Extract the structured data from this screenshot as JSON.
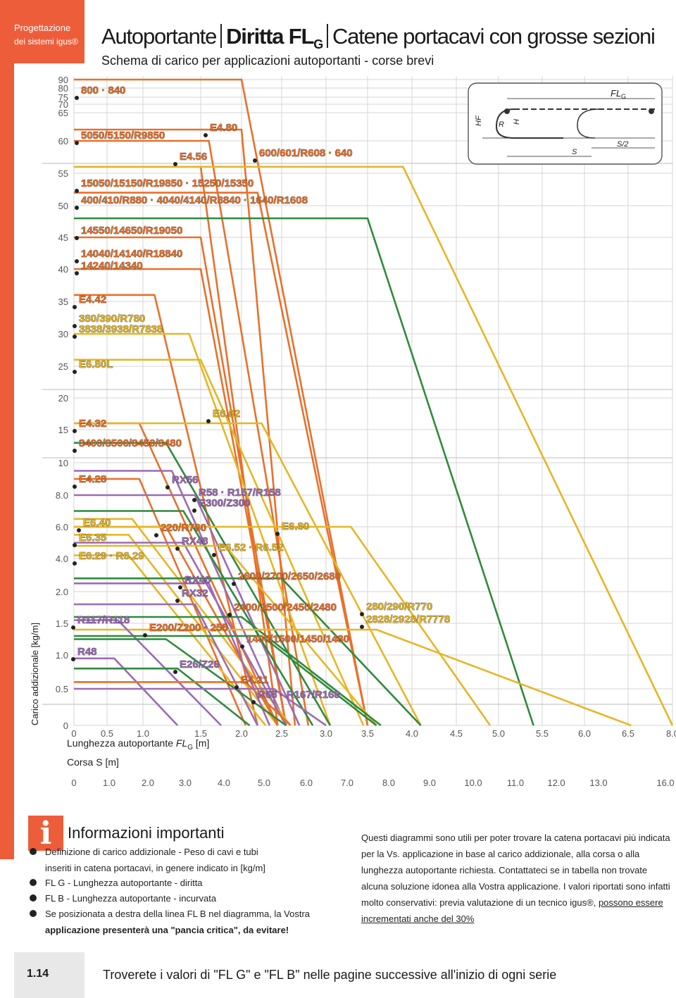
{
  "header": {
    "section_line1": "Progettazione",
    "section_line2": "dei sistemi igus®",
    "title_part1": "Autoportante",
    "title_part2": "Diritta FL",
    "title_part2_sub": "G",
    "title_part3": "Catene portacavi con grosse sezioni",
    "subtitle": "Schema di carico per applicazioni autoportanti - corse brevi"
  },
  "colors": {
    "accent": "#ee5d3a"
  },
  "chart_data": {
    "type": "line",
    "title": "Schema di carico per applicazioni autoportanti - corse brevi",
    "ylabel": "Carico addizionale [kg/m]",
    "xlabel": "Lunghezza autoportante FL",
    "xlabel_sub": "G",
    "xlabel_unit": "[m]",
    "x2label": "Corsa S [m]",
    "y_ticks": [
      "0",
      "0.5",
      "1.0",
      "1.5",
      "2.0",
      "4.0",
      "6.0",
      "8.0",
      "10",
      "15",
      "20",
      "25",
      "30",
      "35",
      "40",
      "45",
      "50",
      "55",
      "60",
      "65",
      "70",
      "75",
      "80",
      "90"
    ],
    "x_ticks": [
      "0",
      "0.5",
      "1.0",
      "1.5",
      "2.0",
      "2.5",
      "3.0",
      "3.5",
      "4.0",
      "4.5",
      "5.0",
      "5.5",
      "6.0",
      "6.5",
      "8.0"
    ],
    "x2_ticks": [
      "0",
      "1.0",
      "2.0",
      "3.0",
      "4.0",
      "5.0",
      "6.0",
      "7.0",
      "8.0",
      "9.0",
      "10.0",
      "11.0",
      "12.0",
      "13.0",
      "16.0"
    ],
    "grid": true,
    "series": [
      {
        "name": "800 · 840",
        "color": "#e8702a",
        "points": [
          [
            0,
            90
          ],
          [
            2.0,
            90
          ],
          [
            3.5,
            0
          ]
        ]
      },
      {
        "name": "5050/5150/R9850",
        "color": "#e8702a",
        "points": [
          [
            0,
            60
          ],
          [
            1.6,
            60
          ],
          [
            2.8,
            0
          ]
        ]
      },
      {
        "name": "E4.80",
        "color": "#e8702a",
        "points": [
          [
            0,
            62
          ],
          [
            2.0,
            62
          ],
          [
            2.65,
            0
          ]
        ]
      },
      {
        "name": "E4.56",
        "color": "#e8702a",
        "points": [
          [
            0,
            56
          ],
          [
            1.5,
            56
          ],
          [
            2.45,
            0
          ]
        ]
      },
      {
        "name": "600/601/R608 · 640",
        "color": "#e6b625",
        "points": [
          [
            0,
            56
          ],
          [
            3.9,
            56
          ],
          [
            8.0,
            0
          ]
        ]
      },
      {
        "name": "15050/15150/R19850 · 15250/15350",
        "color": "#e8702a",
        "points": [
          [
            0,
            52
          ],
          [
            2.2,
            52
          ],
          [
            3.5,
            0
          ]
        ]
      },
      {
        "name": "400/410/R880 · 4040/4140/R8840 · 1640/R1608",
        "color": "#2f8a3d",
        "points": [
          [
            0,
            48
          ],
          [
            3.5,
            48
          ],
          [
            5.4,
            0
          ]
        ]
      },
      {
        "name": "14550/14650/R19050",
        "color": "#e8702a",
        "points": [
          [
            0,
            45
          ],
          [
            1.5,
            45
          ],
          [
            2.55,
            0
          ]
        ]
      },
      {
        "name": "14040/14140/R18840 · 14240/14340",
        "color": "#e8702a",
        "points": [
          [
            0,
            40
          ],
          [
            1.5,
            40
          ],
          [
            2.55,
            0
          ]
        ]
      },
      {
        "name": "E4.42",
        "color": "#e8702a",
        "points": [
          [
            0,
            36
          ],
          [
            1.1,
            36
          ],
          [
            2.2,
            0
          ]
        ]
      },
      {
        "name": "380/390/R780 · 3838/3938/R7838",
        "color": "#e6b625",
        "points": [
          [
            0,
            30
          ],
          [
            1.4,
            30
          ],
          [
            3.05,
            0
          ]
        ]
      },
      {
        "name": "E6.80L",
        "color": "#e6b625",
        "points": [
          [
            0,
            26
          ],
          [
            1.5,
            26
          ],
          [
            3.45,
            0
          ]
        ]
      },
      {
        "name": "E4.32",
        "color": "#e8702a",
        "points": [
          [
            0,
            16
          ],
          [
            0.95,
            16
          ],
          [
            2.45,
            0
          ]
        ]
      },
      {
        "name": "3400/3500/3450/3480",
        "color": "#2f8a3d",
        "points": [
          [
            0,
            13
          ],
          [
            1.2,
            13
          ],
          [
            3.05,
            0
          ]
        ]
      },
      {
        "name": "E6.62",
        "color": "#e6b625",
        "points": [
          [
            0,
            16
          ],
          [
            2.25,
            16
          ],
          [
            4.1,
            0
          ]
        ]
      },
      {
        "name": "E4.28",
        "color": "#e8702a",
        "points": [
          [
            0,
            9
          ],
          [
            0.95,
            9
          ],
          [
            2.05,
            0
          ]
        ]
      },
      {
        "name": "RX56",
        "color": "#9b6bb5",
        "points": [
          [
            0,
            9.5
          ],
          [
            1.25,
            9.5
          ],
          [
            2.55,
            0
          ]
        ]
      },
      {
        "name": "R58 · R157/R158",
        "color": "#9b6bb5",
        "points": [
          [
            0,
            8
          ],
          [
            1.45,
            8
          ],
          [
            2.7,
            0
          ]
        ]
      },
      {
        "name": "E300/Z300",
        "color": "#2f8a3d",
        "points": [
          [
            0,
            7
          ],
          [
            1.35,
            7
          ],
          [
            2.85,
            0
          ]
        ]
      },
      {
        "name": "E6.40",
        "color": "#e6b625",
        "points": [
          [
            0,
            6.5
          ],
          [
            0.85,
            6.5
          ],
          [
            2.6,
            0
          ]
        ]
      },
      {
        "name": "E6.35",
        "color": "#e6b625",
        "points": [
          [
            0,
            5.5
          ],
          [
            0.8,
            5.5
          ],
          [
            2.45,
            0
          ]
        ]
      },
      {
        "name": "E6.29 · R6.29",
        "color": "#e6b625",
        "points": [
          [
            0,
            4.2
          ],
          [
            0.8,
            4.2
          ],
          [
            2.3,
            0
          ]
        ]
      },
      {
        "name": "220/R760",
        "color": "#e8702a",
        "points": [
          [
            0,
            6
          ],
          [
            1.2,
            6
          ],
          [
            2.45,
            0
          ]
        ]
      },
      {
        "name": "RX48",
        "color": "#9b6bb5",
        "points": [
          [
            0,
            5
          ],
          [
            1.35,
            5
          ],
          [
            2.55,
            0
          ]
        ]
      },
      {
        "name": "E6.80",
        "color": "#e6b625",
        "points": [
          [
            0,
            6
          ],
          [
            3.3,
            6
          ],
          [
            4.9,
            0
          ]
        ]
      },
      {
        "name": "E6.52 · R6.52",
        "color": "#e6b625",
        "points": [
          [
            0,
            4.8
          ],
          [
            1.8,
            4.8
          ],
          [
            3.6,
            0
          ]
        ]
      },
      {
        "name": "RX40",
        "color": "#9b6bb5",
        "points": [
          [
            0,
            2.5
          ],
          [
            1.6,
            2.5
          ],
          [
            2.35,
            0
          ]
        ]
      },
      {
        "name": "2600/2700/2650/2680",
        "color": "#2f8a3d",
        "points": [
          [
            0,
            2.8
          ],
          [
            2.5,
            2.8
          ],
          [
            4.1,
            0
          ]
        ]
      },
      {
        "name": "RX32",
        "color": "#9b6bb5",
        "points": [
          [
            0,
            1.8
          ],
          [
            1.45,
            1.8
          ],
          [
            2.2,
            0
          ]
        ]
      },
      {
        "name": "2400/2500/2450/2480",
        "color": "#2f8a3d",
        "points": [
          [
            0,
            1.6
          ],
          [
            2.0,
            1.6
          ],
          [
            3.65,
            0
          ]
        ]
      },
      {
        "name": "280/290/R770 · 2828/2928/R7778",
        "color": "#e6b625",
        "points": [
          [
            0,
            1.4
          ],
          [
            3.6,
            1.4
          ],
          [
            6.6,
            0
          ]
        ]
      },
      {
        "name": "R117/R118",
        "color": "#9b6bb5",
        "points": [
          [
            0,
            1.55
          ],
          [
            0.65,
            1.55
          ],
          [
            1.75,
            0
          ]
        ]
      },
      {
        "name": "E200/Z200 · 255",
        "color": "#2f8a3d",
        "points": [
          [
            0,
            1.25
          ],
          [
            1.2,
            1.25
          ],
          [
            2.55,
            0
          ]
        ]
      },
      {
        "name": "1400/1500/1450/1480",
        "color": "#2f8a3d",
        "points": [
          [
            0,
            1.3
          ],
          [
            2.25,
            1.3
          ],
          [
            3.6,
            0
          ]
        ]
      },
      {
        "name": "R48",
        "color": "#9b6bb5",
        "points": [
          [
            0,
            0.95
          ],
          [
            0.6,
            0.95
          ],
          [
            1.3,
            0
          ]
        ]
      },
      {
        "name": "E26/Z26",
        "color": "#2f8a3d",
        "points": [
          [
            0,
            0.8
          ],
          [
            1.3,
            0.8
          ],
          [
            2.1,
            0
          ]
        ]
      },
      {
        "name": "E4.21",
        "color": "#e8702a",
        "points": [
          [
            0,
            0.6
          ],
          [
            2.05,
            0.6
          ],
          [
            2.6,
            0
          ]
        ]
      },
      {
        "name": "R68 · R167/R168",
        "color": "#9b6bb5",
        "points": [
          [
            0,
            0.5
          ],
          [
            2.4,
            0.5
          ],
          [
            3.0,
            0
          ]
        ]
      }
    ],
    "labels": [
      {
        "text": "800 · 840",
        "color": "#e8702a"
      },
      {
        "text": "5050/5150/R9850",
        "color": "#e8702a"
      },
      {
        "text": "E4.80",
        "color": "#e8702a"
      },
      {
        "text": "E4.56",
        "color": "#e8702a"
      },
      {
        "text": "600/601/R608 · 640",
        "color": "#e8702a"
      },
      {
        "text": "15050/15150/R19850 · 15250/15350",
        "color": "#e8702a"
      },
      {
        "text": "400/410/R880 · 4040/4140/R8840 · 1640/R1608",
        "color": "#e8702a"
      },
      {
        "text": "14550/14650/R19050",
        "color": "#e8702a"
      },
      {
        "text": "14040/14140/R18840",
        "color": "#e8702a"
      },
      {
        "text": "14240/14340",
        "color": "#e8702a"
      },
      {
        "text": "E4.42",
        "color": "#e8702a"
      },
      {
        "text": "380/390/R780",
        "color": "#e6b625"
      },
      {
        "text": "3838/3938/R7838",
        "color": "#e6b625"
      },
      {
        "text": "E6.80L",
        "color": "#e6b625"
      },
      {
        "text": "E4.32",
        "color": "#e8702a"
      },
      {
        "text": "3400/3500/3450/3480",
        "color": "#e8702a"
      },
      {
        "text": "E6.62",
        "color": "#e6b625"
      },
      {
        "text": "E4.28",
        "color": "#e8702a"
      },
      {
        "text": "RX56",
        "color": "#9b6bb5"
      },
      {
        "text": "R58 · R157/R158",
        "color": "#9b6bb5"
      },
      {
        "text": "E300/Z300",
        "color": "#9b6bb5"
      },
      {
        "text": "E6.40",
        "color": "#e6b625"
      },
      {
        "text": "E6.35",
        "color": "#e6b625"
      },
      {
        "text": "E6.29 · R6.29",
        "color": "#e6b625"
      },
      {
        "text": "220/R760",
        "color": "#e8702a"
      },
      {
        "text": "RX48",
        "color": "#9b6bb5"
      },
      {
        "text": "E6.80",
        "color": "#e6b625"
      },
      {
        "text": "E6.52 · R6.52",
        "color": "#e6b625"
      },
      {
        "text": "RX40",
        "color": "#9b6bb5"
      },
      {
        "text": "2600/2700/2650/2680",
        "color": "#e8702a"
      },
      {
        "text": "RX32",
        "color": "#9b6bb5"
      },
      {
        "text": "2400/2500/2450/2480",
        "color": "#e8702a"
      },
      {
        "text": "280/290/R770",
        "color": "#e6b625"
      },
      {
        "text": "2828/2928/R7778",
        "color": "#e6b625"
      },
      {
        "text": "R117/R118",
        "color": "#9b6bb5"
      },
      {
        "text": "E200/Z200 · 255",
        "color": "#e8702a"
      },
      {
        "text": "1400/1500/1450/1480",
        "color": "#e8702a"
      },
      {
        "text": "R48",
        "color": "#9b6bb5"
      },
      {
        "text": "E26/Z26",
        "color": "#9b6bb5"
      },
      {
        "text": "E4.21",
        "color": "#e8702a"
      },
      {
        "text": "R68 · R167/R168",
        "color": "#9b6bb5"
      }
    ],
    "inset": {
      "label_flg": "FL",
      "label_flg_sub": "G",
      "label_hf": "HF",
      "label_r": "R",
      "label_h": "H",
      "label_s": "S",
      "label_s2": "S/2"
    }
  },
  "info": {
    "heading": "Informazioni importanti",
    "bullet1_a": "Definizione di carico addizionale - Peso di cavi e tubi",
    "bullet1_b": "inseriti in catena portacavi, in genere indicato in [kg/m]",
    "bullet2": "FL G - Lunghezza autoportante - diritta",
    "bullet3": "FL B - Lunghezza autoportante - incurvata",
    "bullet4_a": "Se posizionata a destra della linea FL B nel diagramma, la Vostra",
    "bullet4_b": "applicazione presenterà una \"pancia critica\", da evitare!",
    "right_text": "Questi diagrammi sono utili per poter trovare la catena portacavi più indicata per la Vs. applicazione in base al carico addizionale, alla corsa o alla lunghezza autoportante richiesta. Contattateci se in tabella non trovate alcuna soluzione idonea alla Vostra applicazione. I valori riportati sono infatti molto conservativi: previa valutazione di un tecnico igus®,",
    "right_underlined": "possono essere incrementati anche del 30%"
  },
  "footer": {
    "page_number": "1.14",
    "note": "Troverete i valori di \"FL G\" e \"FL B\" nelle pagine successive all'inizio di ogni serie"
  }
}
